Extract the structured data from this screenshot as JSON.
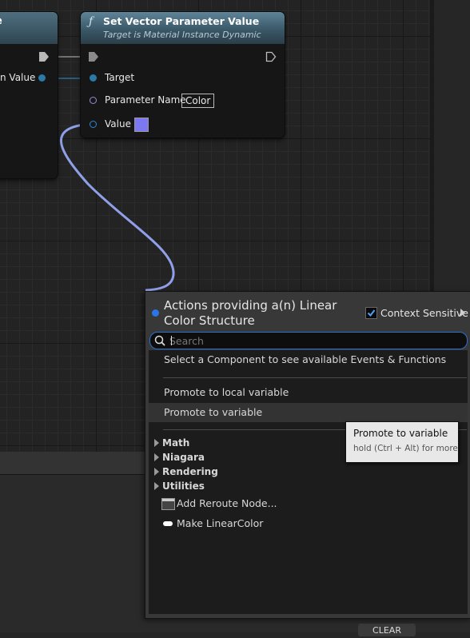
{
  "left_node": {
    "title_fragment": "e",
    "pin_label_fragment": "n Value"
  },
  "set_vector_node": {
    "icon": "function-icon",
    "title": "Set Vector Parameter Value",
    "subtitle": "Target is Material Instance Dynamic",
    "pins": {
      "target": "Target",
      "parameter_name": "Parameter Name",
      "parameter_value": "Color",
      "value": "Value"
    },
    "value_color": "#7b78f2"
  },
  "action_menu": {
    "title": "Actions providing a(n) Linear Color Structure",
    "context_sensitive_label": "Context Sensitive",
    "context_sensitive_checked": true,
    "search": {
      "placeholder": "Search",
      "value": ""
    },
    "hint": "Select a Component to see available Events & Functions",
    "items": [
      {
        "label": "Promote to local variable"
      },
      {
        "label": "Promote to variable"
      }
    ],
    "categories": [
      "Math",
      "Niagara",
      "Rendering",
      "Utilities"
    ],
    "extra_items": [
      {
        "label": "Add Reroute Node...",
        "icon": "reroute-node-icon"
      },
      {
        "label": "Make LinearColor",
        "icon": "struct-pin-icon"
      }
    ]
  },
  "tooltip": {
    "title": "Promote to variable",
    "hint": "hold (Ctrl + Alt) for more"
  },
  "bottom_panel": {
    "clear_button": "CLEAR"
  },
  "colors": {
    "accent": "#2c6fd0",
    "wire": "#8fa0e8",
    "node_header": "#3a5868"
  }
}
